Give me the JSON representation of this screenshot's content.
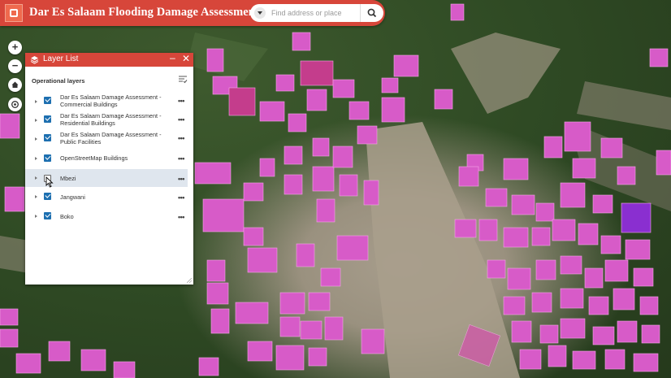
{
  "header": {
    "title": "Dar Es Salaam Flooding Damage Assessment App",
    "search_placeholder": "Find address or place",
    "logo_icon": "app-logo-icon",
    "search_icon": "search-icon",
    "accent_color": "#d7463a"
  },
  "map_controls": {
    "zoom_in": "+",
    "zoom_out": "−",
    "home_icon": "home-icon",
    "locate_icon": "locate-icon"
  },
  "layer_list": {
    "title": "Layer List",
    "section_label": "Operational layers",
    "layers": [
      {
        "label": "Dar Es Salaam Damage Assessment - Commercial Buildings",
        "checked": true
      },
      {
        "label": "Dar Es Salaam Damage Assessment - Residential Buildings",
        "checked": true
      },
      {
        "label": "Dar Es Salaam Damage Assessment - Public Facilities",
        "checked": true
      },
      {
        "label": "OpenStreetMap Buildings",
        "checked": true
      },
      {
        "label": "Mbezi",
        "checked": false
      },
      {
        "label": "Jangwani",
        "checked": true
      },
      {
        "label": "Boko",
        "checked": true
      }
    ],
    "more_label": "•••"
  },
  "colors": {
    "building_fill": "#d75bc8",
    "highlight_row": "#dfe6ee",
    "checkbox_blue": "#1d6fb0"
  }
}
